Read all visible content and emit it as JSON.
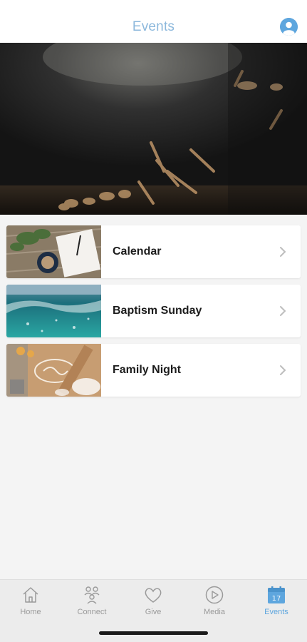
{
  "header": {
    "title": "Events"
  },
  "events": [
    {
      "label": "Calendar",
      "thumb": "calendar-thumbnail-image"
    },
    {
      "label": "Baptism Sunday",
      "thumb": "baptism-thumbnail-image"
    },
    {
      "label": "Family Night",
      "thumb": "family-night-thumbnail-image"
    }
  ],
  "tabs": [
    {
      "label": "Home",
      "icon": "home-icon"
    },
    {
      "label": "Connect",
      "icon": "connect-icon"
    },
    {
      "label": "Give",
      "icon": "heart-icon"
    },
    {
      "label": "Media",
      "icon": "play-icon"
    },
    {
      "label": "Events",
      "icon": "calendar-icon",
      "badge": "17",
      "active": true
    }
  ],
  "colors": {
    "accent": "#5ea6de",
    "header_title": "#8cb8dc",
    "inactive": "#9a9a9a"
  }
}
